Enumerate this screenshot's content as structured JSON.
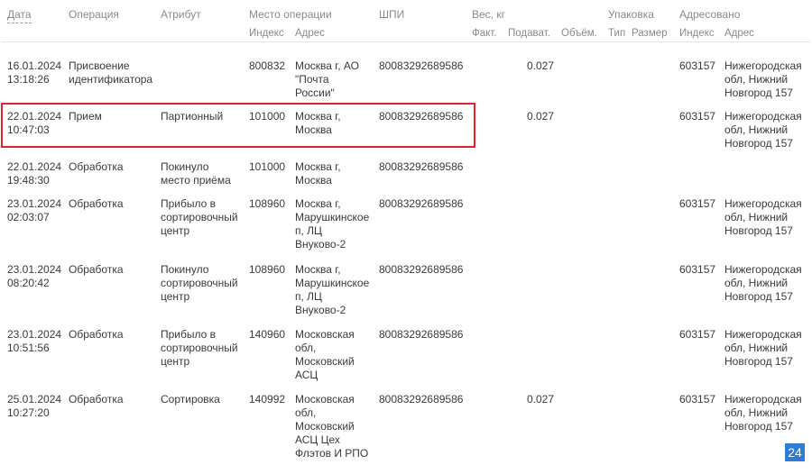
{
  "header": {
    "date": "Дата",
    "operation": "Операция",
    "attribute": "Атрибут",
    "place": "Место операции",
    "shpi": "ШПИ",
    "weight": "Вес, кг",
    "packing": "Упаковка",
    "addressed": "Адресовано",
    "sub": {
      "index": "Индекс",
      "address": "Адрес",
      "fact": "Факт.",
      "submitted": "Подават.",
      "volume": "Объём.",
      "type": "Тип",
      "size": "Размер",
      "addr_index": "Индекс",
      "addr_address": "Адрес"
    }
  },
  "rows": [
    {
      "date": "16.01.2024\n13:18:26",
      "operation": "Присвоение\nидентификатора",
      "attribute": "",
      "index": "800832",
      "address": "Москва г, АО\n\"Почта\nРоссии\"",
      "shpi": "80083292689586",
      "weight": "0.027",
      "addr_index": "603157",
      "addr_address": "Нижегородская\nобл, Нижний\nНовгород 157"
    },
    {
      "date": "22.01.2024\n10:47:03",
      "operation": "Прием",
      "attribute": "Партионный",
      "index": "101000",
      "address": "Москва г,\nМосква",
      "shpi": "80083292689586",
      "weight": "0.027",
      "addr_index": "603157",
      "addr_address": "Нижегородская\nобл, Нижний\nНовгород 157"
    },
    {
      "date": "22.01.2024\n19:48:30",
      "operation": "Обработка",
      "attribute": "Покинуло\nместо приёма",
      "index": "101000",
      "address": "Москва г,\nМосква",
      "shpi": "80083292689586",
      "weight": "",
      "addr_index": "",
      "addr_address": ""
    },
    {
      "date": "23.01.2024\n02:03:07",
      "operation": "Обработка",
      "attribute": "Прибыло в\nсортировочный\nцентр",
      "index": "108960",
      "address": "Москва г,\nМарушкинское\nп, ЛЦ\nВнуково-2",
      "shpi": "80083292689586",
      "weight": "",
      "addr_index": "603157",
      "addr_address": "Нижегородская\nобл, Нижний\nНовгород 157"
    },
    {
      "date": "23.01.2024\n08:20:42",
      "operation": "Обработка",
      "attribute": "Покинуло\nсортировочный\nцентр",
      "index": "108960",
      "address": "Москва г,\nМарушкинское\nп, ЛЦ\nВнуково-2",
      "shpi": "80083292689586",
      "weight": "",
      "addr_index": "603157",
      "addr_address": "Нижегородская\nобл, Нижний\nНовгород 157"
    },
    {
      "date": "23.01.2024\n10:51:56",
      "operation": "Обработка",
      "attribute": "Прибыло в\nсортировочный\nцентр",
      "index": "140960",
      "address": "Московская\nобл,\nМосковский\nАСЦ",
      "shpi": "80083292689586",
      "weight": "",
      "addr_index": "603157",
      "addr_address": "Нижегородская\nобл, Нижний\nНовгород 157"
    },
    {
      "date": "25.01.2024\n10:27:20",
      "operation": "Обработка",
      "attribute": "Сортировка",
      "index": "140992",
      "address": "Московская\nобл,\nМосковский\nАСЦ Цех\nФлэтов И РПО",
      "shpi": "80083292689586",
      "weight": "0.027",
      "addr_index": "603157",
      "addr_address": "Нижегородская\nобл, Нижний\nНовгород 157"
    }
  ],
  "badge": "24",
  "colors": {
    "highlight": "#e2232b",
    "badge": "#2e7cd6"
  }
}
